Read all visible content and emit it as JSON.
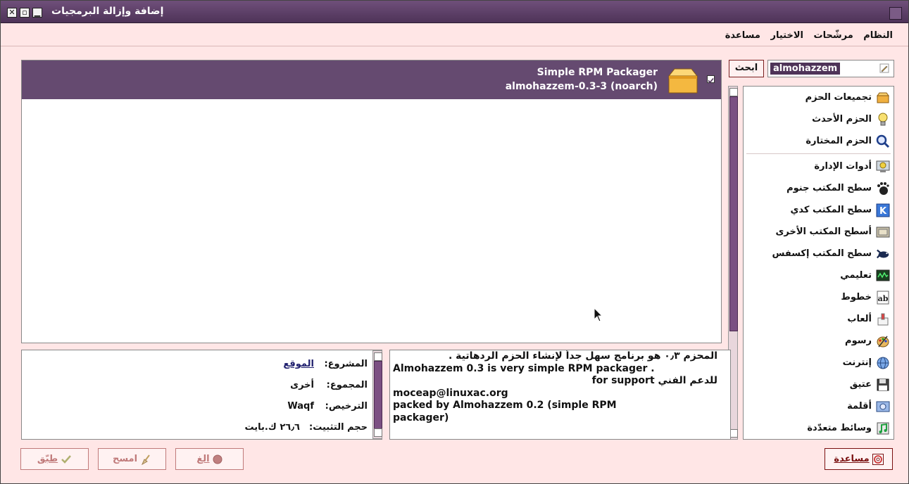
{
  "window": {
    "title": "إضافة وإزالة البرمجيات",
    "controls": [
      "minimize",
      "maximize",
      "close"
    ]
  },
  "menu": {
    "items": [
      "النظام",
      "مرشّحات",
      "الاختيار",
      "مساعدة"
    ]
  },
  "search": {
    "value": "almohazzem",
    "button_label": "ابحث"
  },
  "categories": [
    {
      "label": "تجميعات الحزم",
      "icon": "package-collection-icon"
    },
    {
      "label": "الحزم الأحدث",
      "icon": "new-packages-icon"
    },
    {
      "label": "الحزم المختارة",
      "icon": "magnifier-icon"
    },
    {
      "label": "أدوات الإدارة",
      "icon": "admin-tools-icon"
    },
    {
      "label": "سطح المكتب جنوم",
      "icon": "gnome-foot-icon"
    },
    {
      "label": "سطح المكتب كدي",
      "icon": "kde-icon"
    },
    {
      "label": "أسطح المكتب الأخرى",
      "icon": "other-desktops-icon"
    },
    {
      "label": "سطح المكتب إكسفس",
      "icon": "xfce-mouse-icon"
    },
    {
      "label": "تعليمي",
      "icon": "education-monitor-icon"
    },
    {
      "label": "خطوط",
      "icon": "fonts-icon"
    },
    {
      "label": "ألعاب",
      "icon": "games-icon"
    },
    {
      "label": "رسوم",
      "icon": "graphics-palette-icon"
    },
    {
      "label": "إنترنت",
      "icon": "internet-globe-icon"
    },
    {
      "label": "عتيق",
      "icon": "floppy-disk-icon"
    },
    {
      "label": "أقلمة",
      "icon": "localization-icon"
    },
    {
      "label": "وسائط متعدّدة",
      "icon": "multimedia-icon"
    }
  ],
  "package": {
    "name": "Simple RPM Packager",
    "version": "almohazzem-0.3-3 (noarch)",
    "checked": true
  },
  "details": {
    "project_label": "المشروع:",
    "project_value": "الموقع",
    "group_label": "المجموع:",
    "group_value": "أخرى",
    "license_label": "الترخيص:",
    "license_value": "Waqf",
    "size_label": "حجم التثبيت:",
    "size_value": "٢٦٫٦ ك.بايت"
  },
  "description": {
    "line1": "المحزم ٠٫٣ هو برنامج سهل جداً لإنشاء الحزم الردهاتية .",
    "line2": "Almohazzem 0.3 is very simple RPM packager .",
    "line3": "للدعم الفني for support",
    "line4": "moceap@linuxac.org",
    "line5": "packed by Almohazzem 0.2 (simple RPM",
    "line6": "packager)"
  },
  "buttons": {
    "help": "مساعدة",
    "cancel": "الغ",
    "clear": "امسح",
    "apply": "طبّق"
  },
  "colors": {
    "window_bg": "#ffe6e6",
    "selection": "#654a70",
    "titlebar": "#5a3d64"
  }
}
